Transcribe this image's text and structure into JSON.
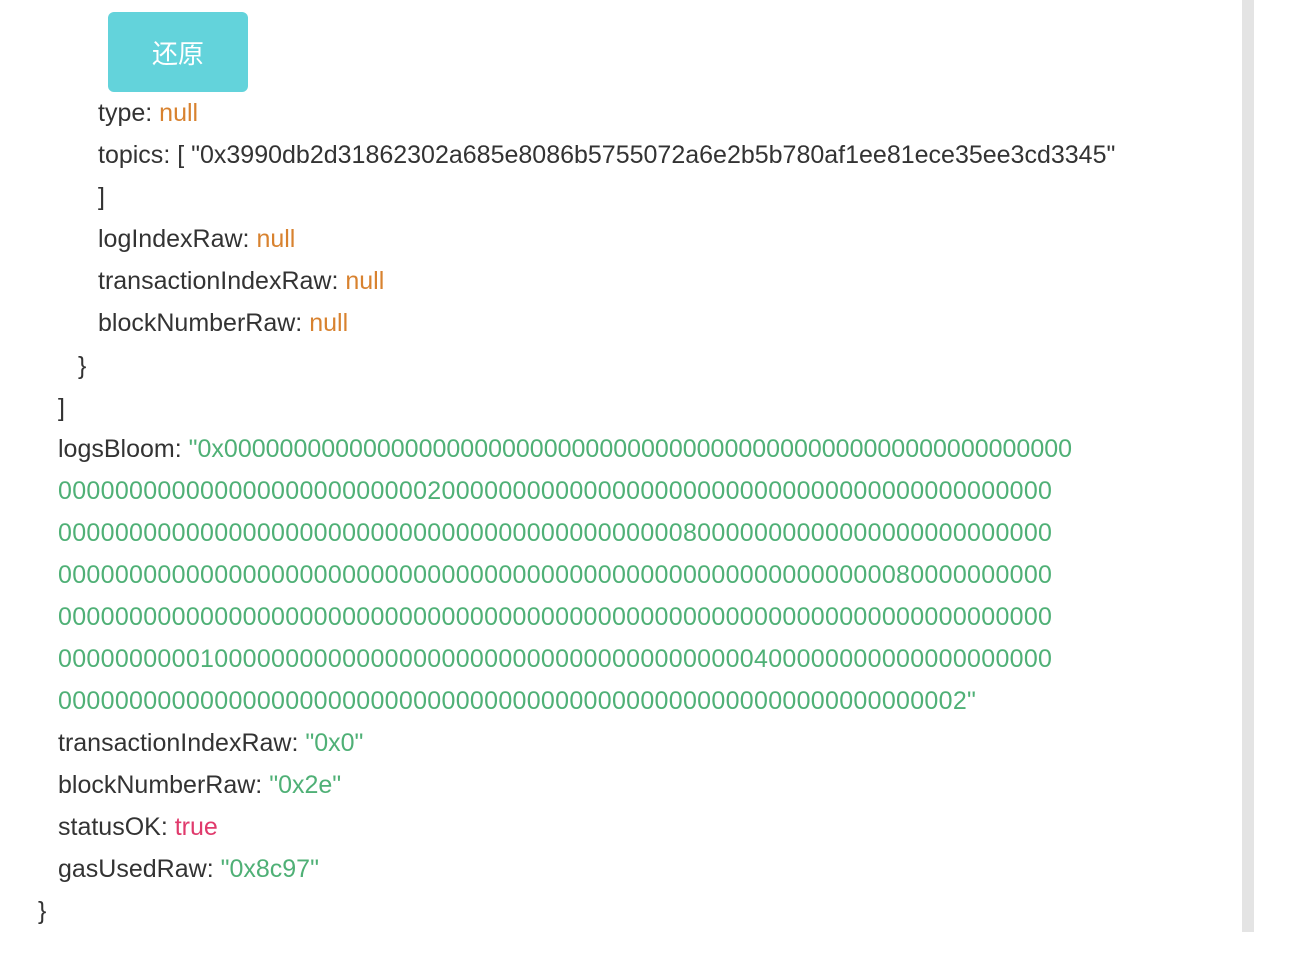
{
  "toolbar": {
    "restore_label": "还原"
  },
  "log_entry": {
    "type_key": "type",
    "type_value": "null",
    "topics_key": "topics",
    "topics_open": "[",
    "topics_value": "\"0x3990db2d31862302a685e8086b5755072a6e2b5b780af1ee81ece35ee3cd3345\"",
    "topics_close": "]",
    "log_index_raw_key": "logIndexRaw",
    "log_index_raw_value": "null",
    "transaction_index_raw_key": "transactionIndexRaw",
    "transaction_index_raw_value": "null",
    "block_number_raw_key": "blockNumberRaw",
    "block_number_raw_value": "null",
    "close_brace": "}"
  },
  "logs_close": "]",
  "logs_bloom": {
    "key": "logsBloom",
    "lines": [
      "\"0x0000000000000000000000000000000000000000000000000000000000000",
      "0000000000000000000000000020000000000000000000000000000000000000000000",
      "0000000000000000000000000000000000000000000080000000000000000000000000",
      "0000000000000000000000000000000000000000000000000000000000080000000000",
      "0000000000000000000000000000000000000000000000000000000000000000000000",
      "0000000000100000000000000000000000000000000000000400000000000000000000",
      "0000000000000000000000000000000000000000000000000000000000000002\""
    ]
  },
  "receipt": {
    "transaction_index_raw_key": "transactionIndexRaw",
    "transaction_index_raw_value": "\"0x0\"",
    "block_number_raw_key": "blockNumberRaw",
    "block_number_raw_value": "\"0x2e\"",
    "status_ok_key": "statusOK",
    "status_ok_value": "true",
    "gas_used_raw_key": "gasUsedRaw",
    "gas_used_raw_value": "\"0x8c97\"",
    "close_brace": "}"
  },
  "colors": {
    "button_bg": "#63d3db",
    "null": "#d8822f",
    "string": "#4fb076",
    "boolean": "#e03a6c",
    "key": "#333333"
  }
}
